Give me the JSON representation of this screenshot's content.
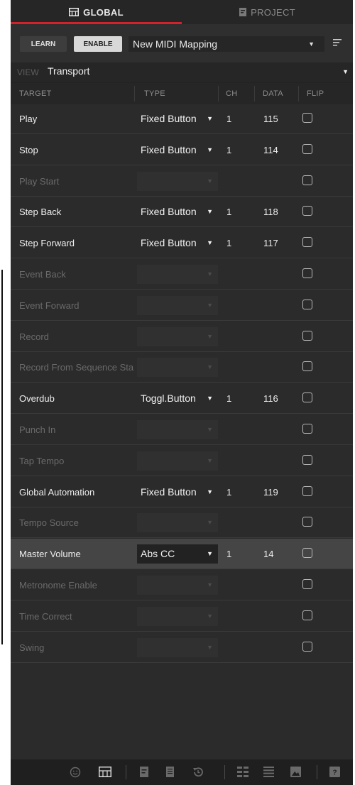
{
  "tabs": {
    "global": "GLOBAL",
    "project": "PROJECT"
  },
  "toolbar": {
    "learn": "LEARN",
    "enable": "ENABLE",
    "mapping": "New MIDI Mapping"
  },
  "view": {
    "label": "VIEW",
    "value": "Transport"
  },
  "headers": {
    "target": "TARGET",
    "type": "TYPE",
    "ch": "CH",
    "data": "DATA",
    "flip": "FLIP"
  },
  "colors": {
    "accent": "#d3212d",
    "panel": "#2b2b2b",
    "highlight_row": "#454545"
  },
  "rows": [
    {
      "target": "Play",
      "type": "Fixed Button",
      "ch": "1",
      "data": "115",
      "active": true
    },
    {
      "target": "Stop",
      "type": "Fixed Button",
      "ch": "1",
      "data": "114",
      "active": true
    },
    {
      "target": "Play Start",
      "type": "",
      "ch": "",
      "data": "",
      "active": false
    },
    {
      "target": "Step Back",
      "type": "Fixed Button",
      "ch": "1",
      "data": "118",
      "active": true
    },
    {
      "target": "Step Forward",
      "type": "Fixed Button",
      "ch": "1",
      "data": "117",
      "active": true
    },
    {
      "target": "Event Back",
      "type": "",
      "ch": "",
      "data": "",
      "active": false
    },
    {
      "target": "Event Forward",
      "type": "",
      "ch": "",
      "data": "",
      "active": false
    },
    {
      "target": "Record",
      "type": "",
      "ch": "",
      "data": "",
      "active": false
    },
    {
      "target": "Record From Sequence Sta",
      "type": "",
      "ch": "",
      "data": "",
      "active": false
    },
    {
      "target": "Overdub",
      "type": "Toggl.Button",
      "ch": "1",
      "data": "116",
      "active": true
    },
    {
      "target": "Punch In",
      "type": "",
      "ch": "",
      "data": "",
      "active": false
    },
    {
      "target": "Tap Tempo",
      "type": "",
      "ch": "",
      "data": "",
      "active": false
    },
    {
      "target": "Global Automation",
      "type": "Fixed Button",
      "ch": "1",
      "data": "119",
      "active": true
    },
    {
      "target": "Tempo Source",
      "type": "",
      "ch": "",
      "data": "",
      "active": false
    },
    {
      "target": "Master Volume",
      "type": "Abs CC",
      "ch": "1",
      "data": "14",
      "active": true,
      "highlight": true
    },
    {
      "target": "Metronome Enable",
      "type": "",
      "ch": "",
      "data": "",
      "active": false
    },
    {
      "target": "Time Correct",
      "type": "",
      "ch": "",
      "data": "",
      "active": false
    },
    {
      "target": "Swing",
      "type": "",
      "ch": "",
      "data": "",
      "active": false
    }
  ],
  "footer_icons": [
    "smiley-icon",
    "keyboard-icon",
    "file-icon",
    "document-icon",
    "history-icon",
    "grid-icon",
    "list-icon",
    "image-icon",
    "help-icon"
  ]
}
